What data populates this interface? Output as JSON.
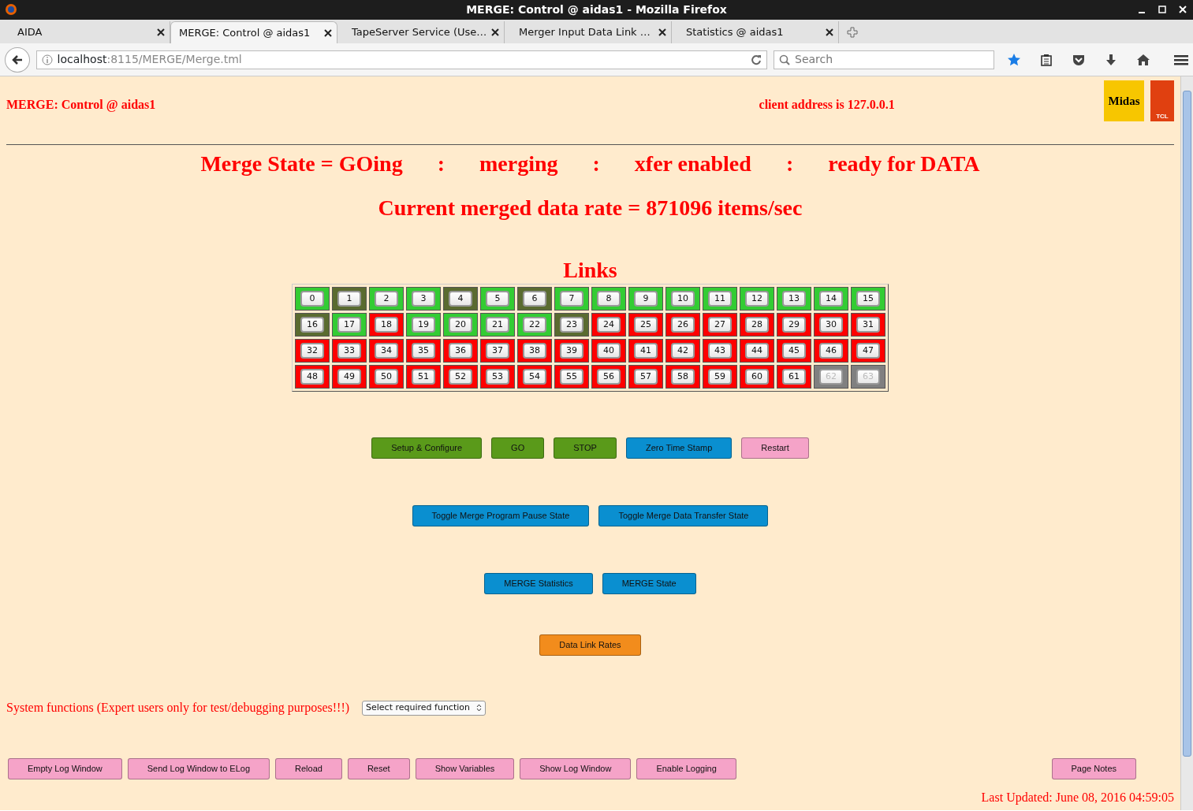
{
  "window": {
    "title": "MERGE: Control @ aidas1 - Mozilla Firefox"
  },
  "tabs": [
    {
      "label": "AIDA",
      "selected": false
    },
    {
      "label": "MERGE: Control @ aidas1",
      "selected": true
    },
    {
      "label": "TapeServer Service (Use…",
      "selected": false
    },
    {
      "label": "Merger Input Data Link …",
      "selected": false
    },
    {
      "label": "Statistics @ aidas1",
      "selected": false
    }
  ],
  "address_bar": {
    "host": "localhost",
    "path": ":8115/MERGE/Merge.tml"
  },
  "search": {
    "placeholder": "Search"
  },
  "page": {
    "title": "MERGE: Control @ aidas1",
    "client_address": "client address is 127.0.0.1",
    "logos": [
      {
        "text": "Midas"
      },
      {
        "text": "TCL"
      }
    ],
    "state_parts": [
      "Merge State = GOing",
      ":",
      "merging",
      ":",
      "xfer enabled",
      ":",
      "ready for DATA"
    ],
    "rate": "Current merged data rate = 871096 items/sec",
    "links_title": "Links",
    "links": [
      {
        "label": "0",
        "color": "#33cc33"
      },
      {
        "label": "1",
        "color": "#5a6b30"
      },
      {
        "label": "2",
        "color": "#33cc33"
      },
      {
        "label": "3",
        "color": "#33cc33"
      },
      {
        "label": "4",
        "color": "#5a6b30"
      },
      {
        "label": "5",
        "color": "#33cc33"
      },
      {
        "label": "6",
        "color": "#5a6b30"
      },
      {
        "label": "7",
        "color": "#33cc33"
      },
      {
        "label": "8",
        "color": "#33cc33"
      },
      {
        "label": "9",
        "color": "#33cc33"
      },
      {
        "label": "10",
        "color": "#33cc33"
      },
      {
        "label": "11",
        "color": "#33cc33"
      },
      {
        "label": "12",
        "color": "#33cc33"
      },
      {
        "label": "13",
        "color": "#33cc33"
      },
      {
        "label": "14",
        "color": "#33cc33"
      },
      {
        "label": "15",
        "color": "#33cc33"
      },
      {
        "label": "16",
        "color": "#5a6b30"
      },
      {
        "label": "17",
        "color": "#33cc33"
      },
      {
        "label": "18",
        "color": "#ff0000"
      },
      {
        "label": "19",
        "color": "#33cc33"
      },
      {
        "label": "20",
        "color": "#33cc33"
      },
      {
        "label": "21",
        "color": "#33cc33"
      },
      {
        "label": "22",
        "color": "#33cc33"
      },
      {
        "label": "23",
        "color": "#5a6b30"
      },
      {
        "label": "24",
        "color": "#ff0000"
      },
      {
        "label": "25",
        "color": "#ff0000"
      },
      {
        "label": "26",
        "color": "#ff0000"
      },
      {
        "label": "27",
        "color": "#ff0000"
      },
      {
        "label": "28",
        "color": "#ff0000"
      },
      {
        "label": "29",
        "color": "#ff0000"
      },
      {
        "label": "30",
        "color": "#ff0000"
      },
      {
        "label": "31",
        "color": "#ff0000"
      },
      {
        "label": "32",
        "color": "#ff0000"
      },
      {
        "label": "33",
        "color": "#ff0000"
      },
      {
        "label": "34",
        "color": "#ff0000"
      },
      {
        "label": "35",
        "color": "#ff0000"
      },
      {
        "label": "36",
        "color": "#ff0000"
      },
      {
        "label": "37",
        "color": "#ff0000"
      },
      {
        "label": "38",
        "color": "#ff0000"
      },
      {
        "label": "39",
        "color": "#ff0000"
      },
      {
        "label": "40",
        "color": "#ff0000"
      },
      {
        "label": "41",
        "color": "#ff0000"
      },
      {
        "label": "42",
        "color": "#ff0000"
      },
      {
        "label": "43",
        "color": "#ff0000"
      },
      {
        "label": "44",
        "color": "#ff0000"
      },
      {
        "label": "45",
        "color": "#ff0000"
      },
      {
        "label": "46",
        "color": "#ff0000"
      },
      {
        "label": "47",
        "color": "#ff0000"
      },
      {
        "label": "48",
        "color": "#ff0000"
      },
      {
        "label": "49",
        "color": "#ff0000"
      },
      {
        "label": "50",
        "color": "#ff0000"
      },
      {
        "label": "51",
        "color": "#ff0000"
      },
      {
        "label": "52",
        "color": "#ff0000"
      },
      {
        "label": "53",
        "color": "#ff0000"
      },
      {
        "label": "54",
        "color": "#ff0000"
      },
      {
        "label": "55",
        "color": "#ff0000"
      },
      {
        "label": "56",
        "color": "#ff0000"
      },
      {
        "label": "57",
        "color": "#ff0000"
      },
      {
        "label": "58",
        "color": "#ff0000"
      },
      {
        "label": "59",
        "color": "#ff0000"
      },
      {
        "label": "60",
        "color": "#ff0000"
      },
      {
        "label": "61",
        "color": "#ff0000"
      },
      {
        "label": "62",
        "color": "#808080",
        "disabled": true
      },
      {
        "label": "63",
        "color": "#808080",
        "disabled": true
      }
    ],
    "button_rows": [
      [
        {
          "label": "Setup & Configure",
          "color": "#5a9a1a"
        },
        {
          "label": "GO",
          "color": "#5a9a1a"
        },
        {
          "label": "STOP",
          "color": "#5a9a1a"
        },
        {
          "label": "Zero Time Stamp",
          "color": "#0a8fd0"
        },
        {
          "label": "Restart",
          "color": "#f5a3c8"
        }
      ],
      [
        {
          "label": "Toggle Merge Program Pause State",
          "color": "#0a8fd0"
        },
        {
          "label": "Toggle Merge Data Transfer State",
          "color": "#0a8fd0"
        }
      ],
      [
        {
          "label": "MERGE Statistics",
          "color": "#0a8fd0"
        },
        {
          "label": "MERGE State",
          "color": "#0a8fd0"
        }
      ],
      [
        {
          "label": "Data Link Rates",
          "color": "#f28c1c"
        }
      ]
    ],
    "system_functions": {
      "label": "System functions (Expert users only for test/debugging purposes!!!)",
      "select": "Select required function"
    },
    "bottom_buttons": [
      {
        "label": "Empty Log Window"
      },
      {
        "label": "Send Log Window to ELog"
      },
      {
        "label": "Reload"
      },
      {
        "label": "Reset"
      },
      {
        "label": "Show Variables"
      },
      {
        "label": "Show Log Window"
      },
      {
        "label": "Enable Logging"
      }
    ],
    "page_notes_button": {
      "label": "Page Notes"
    },
    "last_updated": "Last Updated: June 08, 2016 04:59:05"
  }
}
